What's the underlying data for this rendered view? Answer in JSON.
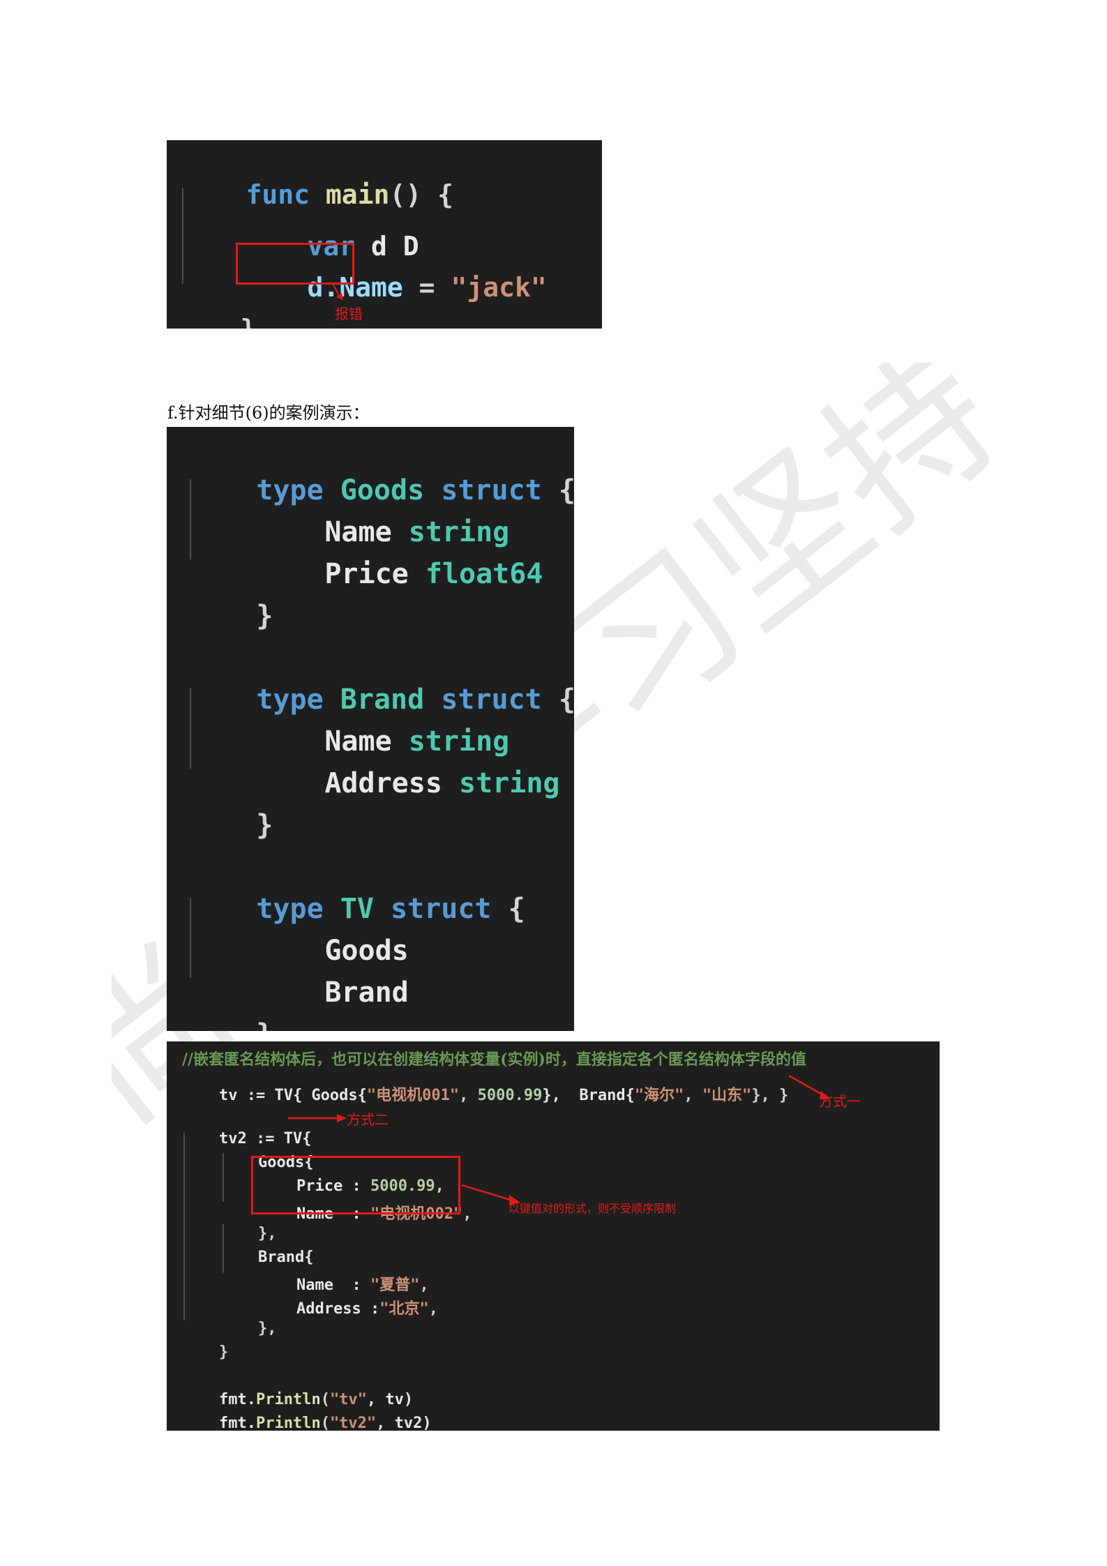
{
  "block1": {
    "lines": [
      {
        "kw": "func",
        "fn": "main",
        "rest": "() {"
      },
      {
        "kw": "var",
        "rest": " d D"
      },
      {
        "a": "d.Name",
        "rest": " = ",
        "str": "\"jack\""
      },
      {
        "rest": "}"
      }
    ],
    "annotation": "报错"
  },
  "caption": "f.针对细节(6)的案例演示：",
  "block2": {
    "structs": [
      {
        "kw": "type",
        "name": "Goods",
        "kw2": "struct",
        "fields": [
          {
            "name": "Name",
            "type": "string"
          },
          {
            "name": "Price",
            "type": "float64"
          }
        ]
      },
      {
        "kw": "type",
        "name": "Brand",
        "kw2": "struct",
        "fields": [
          {
            "name": "Name",
            "type": "string"
          },
          {
            "name": "Address",
            "type": "string"
          }
        ]
      },
      {
        "kw": "type",
        "name": "TV",
        "kw2": "struct",
        "fields": [
          {
            "name": "Goods",
            "type": ""
          },
          {
            "name": "Brand",
            "type": ""
          }
        ]
      }
    ],
    "brace_open": "{",
    "brace_close": "}"
  },
  "block3": {
    "comment": "//嵌套匿名结构体后，也可以在创建结构体变量(实例)时，直接指定各个匿名结构体字段的值",
    "line_tv": {
      "p1": "tv := TV{ Goods{",
      "s1": "\"电视机001\"",
      "p2": ", ",
      "n1": "5000.99",
      "p3": "},  Brand{",
      "s2": "\"海尔\"",
      "p4": ", ",
      "s3": "\"山东\"",
      "p5": "}, }"
    },
    "line_tv2": "tv2 := TV{",
    "goods_open": "Goods{",
    "price_key": "Price : ",
    "price_val": "5000.99",
    "price_end": ",",
    "name_key": "Name  : ",
    "name_val": "\"电视机002\"",
    "name_end": ",",
    "goods_close": "},",
    "brand_open": "Brand{",
    "bname_key": "Name  : ",
    "bname_val": "\"夏普\"",
    "bname_end": ",",
    "addr_key": "Address :",
    "addr_val": "\"北京\"",
    "addr_end": ",",
    "brand_close": "},",
    "tv2_close": "}",
    "println1_a": "fmt.",
    "println1_fn": "Println",
    "println1_b": "(",
    "println1_s": "\"tv\"",
    "println1_c": ", tv)",
    "println2_a": "fmt.",
    "println2_fn": "Println",
    "println2_b": "(",
    "println2_s": "\"tv2\"",
    "println2_c": ", tv2)",
    "annotations": {
      "way1": "方式一",
      "way2": "方式二",
      "kv": "以键值对的形式，则不受顺序限制"
    }
  },
  "watermark": "尚硅谷学习坚持"
}
